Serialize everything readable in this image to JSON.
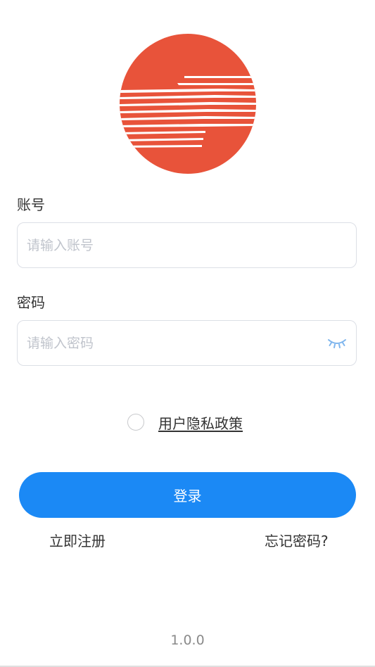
{
  "logo": {
    "icon": "sun-logo-icon",
    "color": "#e8533a"
  },
  "account": {
    "label": "账号",
    "placeholder": "请输入账号",
    "value": ""
  },
  "password": {
    "label": "密码",
    "placeholder": "请输入密码",
    "value": "",
    "toggle_icon": "eye-closed-icon"
  },
  "agreement": {
    "checked": false,
    "link_text": "用户隐私政策"
  },
  "login_button": {
    "label": "登录",
    "color": "#1b89f5"
  },
  "links": {
    "register": "立即注册",
    "forgot_password": "忘记密码?"
  },
  "version": "1.0.0"
}
